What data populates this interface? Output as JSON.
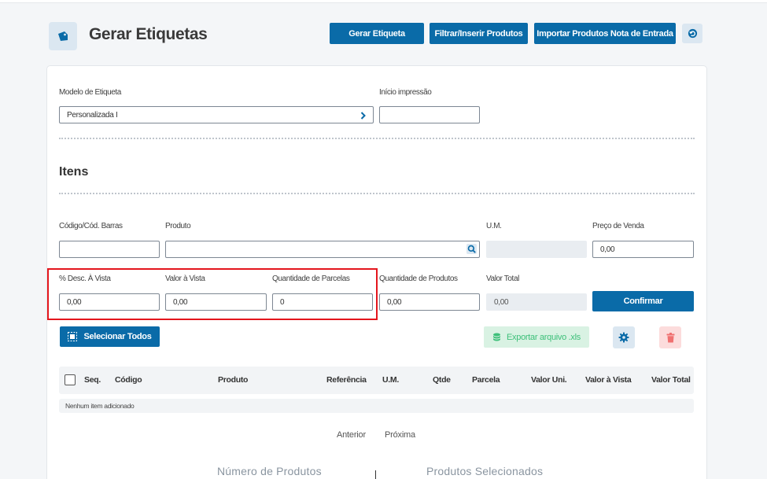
{
  "header": {
    "title": "Gerar Etiquetas",
    "buttons": {
      "gerar": "Gerar Etiqueta",
      "filtrar": "Filtrar/Inserir Produtos",
      "importar": "Importar Produtos Nota de Entrada"
    }
  },
  "form": {
    "modelo_label": "Modelo de Etiqueta",
    "modelo_value": "Personalizada I",
    "inicio_label": "Início impressão",
    "inicio_value": ""
  },
  "itens": {
    "title": "Itens",
    "codigo_label": "Código/Cód. Barras",
    "codigo_value": "",
    "produto_label": "Produto",
    "produto_value": "",
    "um_label": "U.M.",
    "um_value": "",
    "preco_label": "Preço de Venda",
    "preco_value": "0,00",
    "desc_label": "% Desc. À Vista",
    "desc_value": "0,00",
    "valor_vista_label": "Valor à Vista",
    "valor_vista_value": "0,00",
    "parcelas_label": "Quantidade de Parcelas",
    "parcelas_value": "0",
    "qtd_produtos_label": "Quantidade de Produtos",
    "qtd_produtos_value": "0,00",
    "valor_total_label": "Valor Total",
    "valor_total_value": "0,00",
    "confirmar": "Confirmar"
  },
  "actions": {
    "selecionar_todos": "Selecionar Todos",
    "exportar": "Exportar arquivo .xls"
  },
  "table": {
    "columns": [
      "Seq.",
      "Código",
      "Produto",
      "Referência",
      "U.M.",
      "Qtde",
      "Parcela",
      "Valor Uni.",
      "Valor à Vista",
      "Valor Total"
    ],
    "empty": "Nenhum item adicionado"
  },
  "pagination": {
    "anterior": "Anterior",
    "proxima": "Próxima"
  },
  "stats": {
    "numero_produtos": "Número de Produtos",
    "produtos_selecionados": "Produtos Selecionados"
  },
  "colors": {
    "primary": "#0a6ba8",
    "highlight": "#e4161d",
    "export": "#3ec07a",
    "danger": "#f07070"
  }
}
